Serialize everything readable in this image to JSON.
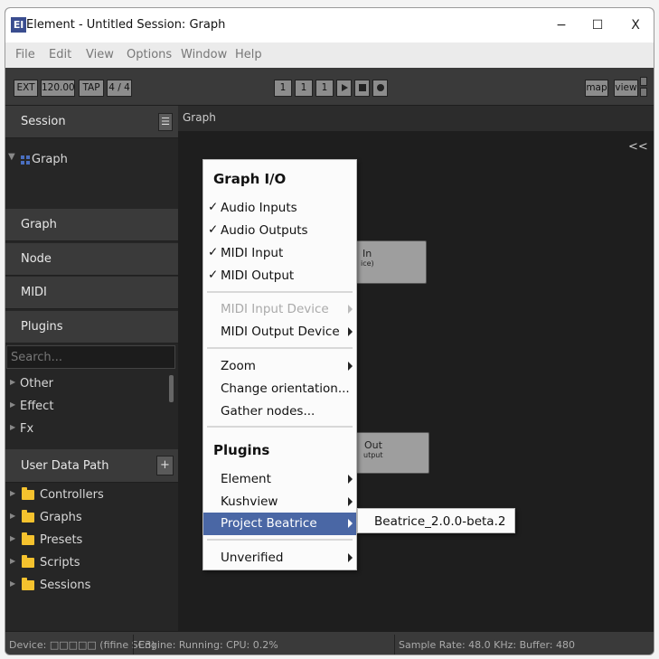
{
  "window": {
    "app_icon": "El",
    "title": "Element - Untitled Session: Graph",
    "minimize": "−",
    "maximize": "☐",
    "close": "X"
  },
  "menubar": [
    "File",
    "Edit",
    "View",
    "Options",
    "Window",
    "Help"
  ],
  "toolbar": {
    "ext": "EXT",
    "tempo": "120.00",
    "tap": "TAP",
    "meter": "4 / 4",
    "counter1": "1",
    "counter2": "1",
    "counter3": "1",
    "play_icon": "play-icon",
    "stop_icon": "stop-icon",
    "record_icon": "record-icon",
    "map": "map",
    "view": "view"
  },
  "sidebar": {
    "session_label": "Session",
    "session_menu_icon": "hamburger-icon",
    "session_tree": [
      {
        "label": "Graph",
        "icon": "grid-icon"
      }
    ],
    "sections": [
      "Graph",
      "Node",
      "MIDI",
      "Plugins"
    ],
    "search_placeholder": "Search...",
    "plugin_categories": [
      "Other",
      "Effect",
      "Fx"
    ],
    "user_data_label": "User Data Path",
    "user_data_add": "+",
    "folders": [
      "Controllers",
      "Graphs",
      "Presets",
      "Scripts",
      "Sessions"
    ]
  },
  "main": {
    "tab_label": "Graph",
    "collapse_button": "<<",
    "nodes": [
      {
        "title": "In",
        "subtitle": "ice)"
      },
      {
        "title": "Out",
        "subtitle": "utput"
      }
    ]
  },
  "context_menu": {
    "section1_title": "Graph I/O",
    "io_items": [
      {
        "check": "✓",
        "label": "Audio Inputs"
      },
      {
        "check": "✓",
        "label": "Audio Outputs"
      },
      {
        "check": "✓",
        "label": "MIDI Input"
      },
      {
        "check": "✓",
        "label": "MIDI Output"
      }
    ],
    "device_items": [
      {
        "label": "MIDI Input Device",
        "enabled": false
      },
      {
        "label": "MIDI Output Device",
        "enabled": true
      }
    ],
    "view_items": [
      "Zoom",
      "Change orientation...",
      "Gather nodes..."
    ],
    "section2_title": "Plugins",
    "plugin_items": [
      "Element",
      "Kushview",
      "Project Beatrice"
    ],
    "selected_item": "Project Beatrice",
    "unverified": "Unverified",
    "submenu_item": "Beatrice_2.0.0-beta.2",
    "colors": {
      "highlight": "#4a67a5",
      "background": "#fbfbfb"
    }
  },
  "statusbar": {
    "device": "Device: □□□□□ (fifine SC3)",
    "engine": "Engine: Running:  CPU: 0.2%",
    "sample": "Sample Rate: 48.0 KHz:  Buffer: 480"
  }
}
